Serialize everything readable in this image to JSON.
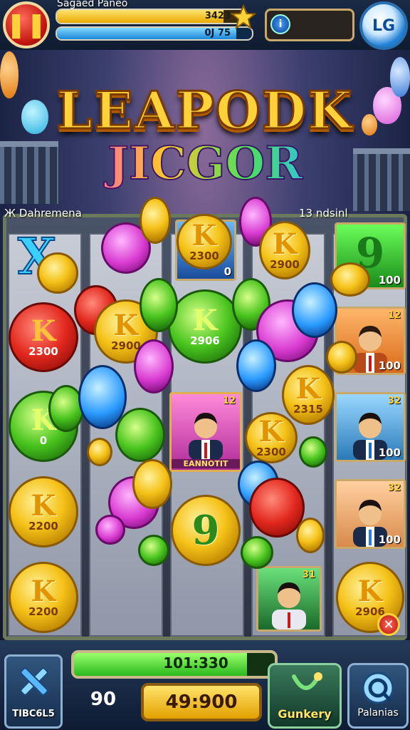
{
  "hud": {
    "player_name": "Sagaed Paneo",
    "gold_value": "3423",
    "gold_fill": 0.88,
    "blue_value": "0J 75",
    "blue_fill": 0.92,
    "info_icon": "info-icon",
    "level_badge": "LG"
  },
  "banner": {
    "line1": "LEAPODK",
    "line2": "JICGOR"
  },
  "board": {
    "left_label": "Ж Dahremena",
    "right_label": "13 ndsinl",
    "coins": [
      {
        "k": "X",
        "v": ""
      },
      {
        "k": "K",
        "v": "2300"
      },
      {
        "k": "K",
        "v": "2900"
      },
      {
        "k": "K",
        "v": "2300"
      },
      {
        "k": "K",
        "v": "2900"
      },
      {
        "k": "K",
        "v": "2906"
      },
      {
        "k": "K",
        "v": "2900"
      },
      {
        "k": "K",
        "v": "2300"
      },
      {
        "k": "K",
        "v": "2300"
      },
      {
        "k": "K",
        "v": "2200"
      },
      {
        "k": "K",
        "v": "2200"
      },
      {
        "k": "K",
        "v": "0"
      },
      {
        "k": "K",
        "v": "2315"
      },
      {
        "k": "9",
        "v": ""
      },
      {
        "k": "K",
        "v": "2906"
      },
      {
        "k": "9",
        "v": ""
      }
    ],
    "tiles": [
      {
        "label": "0",
        "corner": ""
      },
      {
        "label": "100",
        "corner": ""
      },
      {
        "label": "100",
        "corner": "12"
      },
      {
        "label": "100",
        "corner": "32"
      },
      {
        "label": "100",
        "corner": "32"
      },
      {
        "label": "",
        "corner": "31"
      },
      {
        "label": "EANNOTIT",
        "corner": "12"
      }
    ]
  },
  "bottom": {
    "left_label": "TIBC6L5",
    "progress_text": "101:330",
    "progress_fill": 0.86,
    "count": "90",
    "bet": "49:900",
    "gunkery": "Gunkery",
    "palanias": "Palanias",
    "close_icon": "close-icon"
  },
  "colors": {
    "accent_gold": "#f5c218",
    "accent_blue": "#2a9aff",
    "pause_red": "#c1160f",
    "progress_green": "#2ab81e"
  }
}
